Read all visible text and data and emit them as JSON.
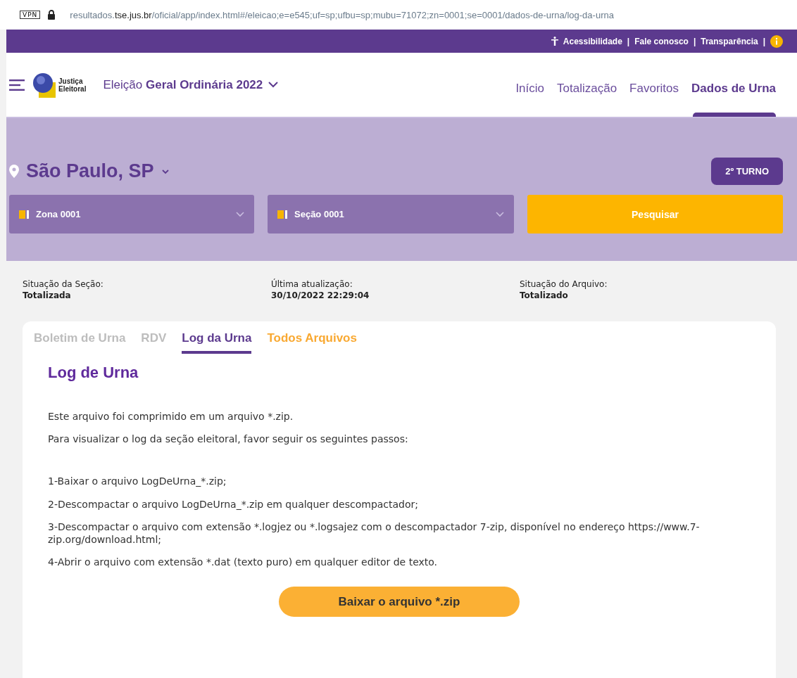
{
  "address_bar": {
    "vpn_badge": "VPN",
    "url_prefix": "resultados.",
    "url_domain": "tse.jus.br",
    "url_path": "/oficial/app/index.html#/eleicao;e=e545;uf=sp;ufbu=sp;mubu=71072;zn=0001;se=0001/dados-de-urna/log-da-urna"
  },
  "top_bar": {
    "links": [
      "Acessibilidade",
      "Fale conosco",
      "Transparência"
    ],
    "separator": "|"
  },
  "header": {
    "logo_lines": [
      "Justiça",
      "Eleitoral"
    ],
    "election_prefix": "Eleição",
    "election_name": "Geral Ordinária 2022",
    "nav": [
      {
        "label": "Início",
        "selected": false
      },
      {
        "label": "Totalização",
        "selected": false
      },
      {
        "label": "Favoritos",
        "selected": false
      },
      {
        "label": "Dados de Urna",
        "selected": true
      }
    ]
  },
  "location": {
    "name": "São Paulo, SP",
    "round_button": "2º TURNO"
  },
  "filters": [
    {
      "label": "Zona 0001"
    },
    {
      "label": "Seção 0001"
    }
  ],
  "search_button": "Pesquisar",
  "status": [
    {
      "label": "Situação da Seção:",
      "value": "Totalizada"
    },
    {
      "label": "Última atualização:",
      "value": "30/10/2022 22:29:04"
    },
    {
      "label": "Situação do Arquivo:",
      "value": "Totalizado"
    }
  ],
  "tabs": [
    {
      "label": "Boletim de Urna",
      "selected": false,
      "color": "#bdbdbd"
    },
    {
      "label": "RDV",
      "selected": false,
      "color": "#bdbdbd"
    },
    {
      "label": "Log da Urna",
      "selected": true,
      "color": "#5c3a8e"
    },
    {
      "label": "Todos Arquivos",
      "selected": false,
      "color": "#f9a932"
    }
  ],
  "content": {
    "title": "Log de Urna",
    "intro": [
      "Este arquivo foi comprimido em um arquivo *.zip.",
      "Para visualizar o log da seção eleitoral, favor seguir os seguintes passos:"
    ],
    "steps": [
      "1-Baixar o arquivo LogDeUrna_*.zip;",
      "2-Descompactar o arquivo LogDeUrna_*.zip em qualquer descompactador;",
      "3-Descompactar o arquivo com extensão *.logjez ou *.logsajez com o descompactador 7-zip, disponível no endereço https://www.7-zip.org/download.html;",
      "4-Abrir o arquivo com extensão *.dat (texto puro) em qualquer editor de texto."
    ],
    "download_button": "Baixar o arquivo *.zip"
  }
}
